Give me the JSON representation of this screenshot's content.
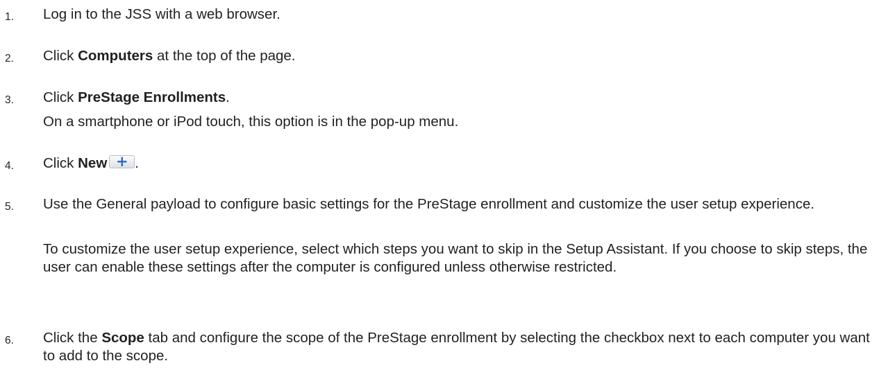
{
  "steps": [
    {
      "number": "1.",
      "text": "Log in to the JSS with a web browser."
    },
    {
      "number": "2.",
      "pre": "Click ",
      "bold": "Computers",
      "post": " at the top of the page."
    },
    {
      "number": "3.",
      "pre": "Click ",
      "bold": "PreStage Enrollments",
      "post": ".",
      "note": "On a smartphone or iPod touch, this option is in the pop-up menu."
    },
    {
      "number": "4.",
      "pre": "Click ",
      "bold": "New",
      "post": ".",
      "button_icon": "plus-icon"
    },
    {
      "number": "5.",
      "text": "Use the General payload to configure basic settings for the PreStage enrollment and customize the user setup experience.",
      "note": "To customize the user setup experience, select which steps you want to skip in the Setup Assistant. If you choose to skip steps, the user can enable these settings after the computer is configured unless otherwise restricted."
    },
    {
      "number": "6.",
      "pre": "Click the ",
      "bold": "Scope",
      "post": " tab and configure the scope of the PreStage enrollment by selecting the checkbox next to each computer you want to add to the scope."
    }
  ]
}
